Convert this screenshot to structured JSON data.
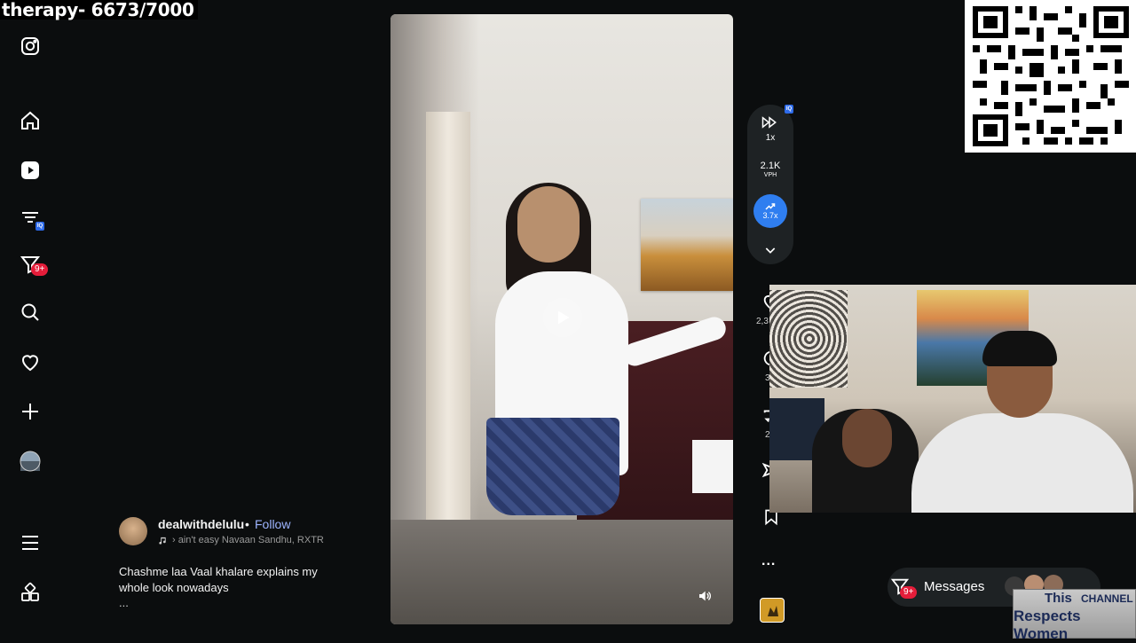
{
  "overlay": {
    "title": "therapy- 6673/7000"
  },
  "nav": {
    "items": [
      {
        "icon": "instagram-icon"
      },
      {
        "icon": "home-icon"
      },
      {
        "icon": "reels-icon"
      },
      {
        "icon": "filter-list-icon",
        "chip": "IQ"
      },
      {
        "icon": "filter-icon",
        "badge": "9+"
      },
      {
        "icon": "search-icon"
      },
      {
        "icon": "heart-icon"
      },
      {
        "icon": "plus-icon"
      },
      {
        "icon": "profile-avatar"
      },
      {
        "icon": "menu-icon"
      },
      {
        "icon": "apps-icon"
      }
    ]
  },
  "post": {
    "username": "dealwithdelulu",
    "separator": "•",
    "follow": "Follow",
    "audio": "› ain't easy   Navaan Sandhu, RXTR",
    "caption": "Chashme laa Vaal khalare explains my whole look nowadays",
    "more": "..."
  },
  "controls": {
    "speed": "1x",
    "vph_value": "2.1K",
    "vph_label": "VPH",
    "trend_value": "3.7x",
    "iq_chip": "IQ"
  },
  "actions": {
    "like_count": "2,3",
    "comment_count": "3",
    "repost_count": "2",
    "more": "..."
  },
  "messages": {
    "label": "Messages",
    "badge": "9+"
  },
  "channel_banner": {
    "line1_a": "This",
    "line1_b": "CHANNEL",
    "line2": "Respects Women"
  },
  "colors": {
    "accent_blue": "#2f7ef0",
    "badge_red": "#e51d3a",
    "follow_link": "#9db4ff"
  }
}
